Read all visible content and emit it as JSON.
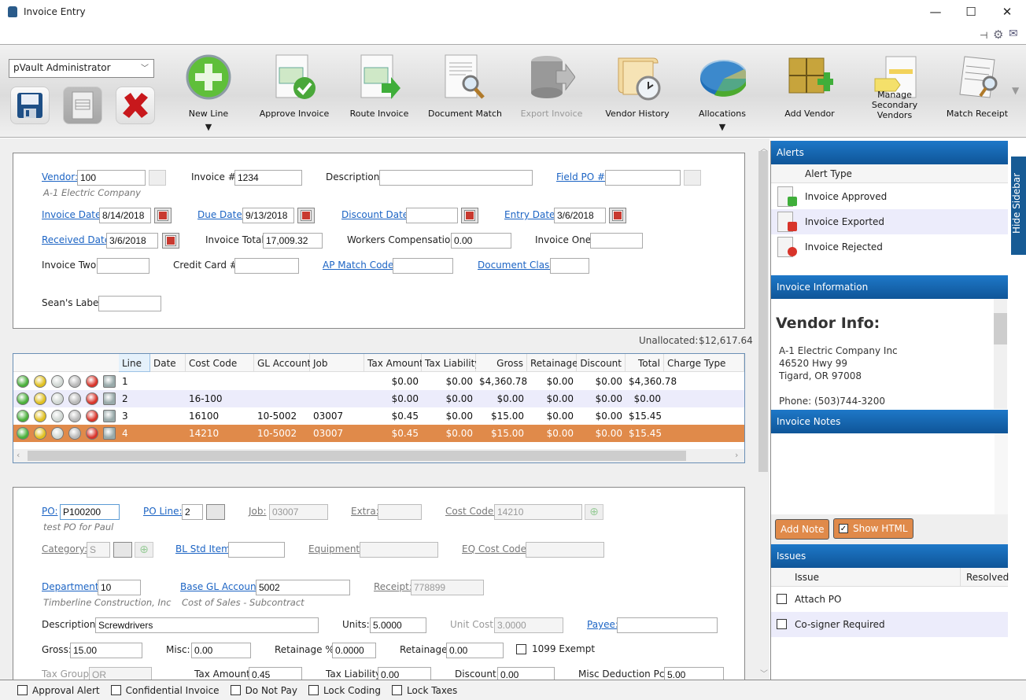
{
  "window": {
    "title": "Invoice Entry",
    "minimize": "—",
    "maximize": "☐",
    "close": "✕"
  },
  "toolbar": {
    "user_select": "pVault Administrator",
    "buttons": [
      {
        "label": "New Line",
        "icon": "plus-circle-icon",
        "dropdown": true
      },
      {
        "label": "Approve Invoice",
        "icon": "invoice-check-icon"
      },
      {
        "label": "Route Invoice",
        "icon": "invoice-arrow-icon"
      },
      {
        "label": "Document Match",
        "icon": "document-magnifier-icon"
      },
      {
        "label": "Export Invoice",
        "icon": "database-export-icon",
        "disabled": true
      },
      {
        "label": "Vendor History",
        "icon": "scroll-clock-icon"
      },
      {
        "label": "Allocations",
        "icon": "pie-chart-icon",
        "dropdown": true
      },
      {
        "label": "Add Vendor",
        "icon": "box-plus-icon"
      },
      {
        "label": "Manage Secondary Vendors",
        "icon": "quotation-tag-icon"
      },
      {
        "label": "Match Receipt",
        "icon": "receipt-magnifier-icon"
      }
    ],
    "caret": "▼"
  },
  "header": {
    "vendor_label": "Vendor:",
    "vendor": "100",
    "vendor_name": "A-1 Electric Company",
    "invoice_no_label": "Invoice #:",
    "invoice_no": "1234",
    "description_label": "Description:",
    "description": "",
    "field_po_label": "Field PO #:",
    "field_po": "",
    "invoice_date_label": "Invoice Date:",
    "invoice_date": "8/14/2018",
    "due_date_label": "Due Date:",
    "due_date": "9/13/2018",
    "discount_date_label": "Discount Date:",
    "discount_date": "",
    "entry_date_label": "Entry Date:",
    "entry_date": "3/6/2018",
    "received_date_label": "Received Date:",
    "received_date": "3/6/2018",
    "invoice_total_label": "Invoice Total:",
    "invoice_total": "17,009.32",
    "workers_comp_label": "Workers Compensation:",
    "workers_comp": "0.00",
    "invoice_one_label": "Invoice One:",
    "invoice_one": "",
    "invoice_two_label": "Invoice Two:",
    "invoice_two": "",
    "credit_card_label": "Credit Card #:",
    "credit_card": "",
    "ap_match_label": "AP Match Code:",
    "ap_match": "",
    "doc_class_label": "Document Class:",
    "doc_class": "",
    "seans_label_label": "Sean's Label:",
    "seans_label": ""
  },
  "unallocated": {
    "label": "Unallocated:",
    "value": "$12,617.64"
  },
  "grid": {
    "columns": [
      "Line",
      "Date",
      "Cost Code",
      "GL Account",
      "Job",
      "Tax Amount",
      "Tax Liability",
      "Gross",
      "Retainage",
      "Discount",
      "Total",
      "Charge Type"
    ],
    "rows": [
      {
        "line": "1",
        "date": "",
        "cost_code": "",
        "gl": "",
        "job": "",
        "tax": "$0.00",
        "liab": "$0.00",
        "gross": "$4,360.78",
        "ret": "$0.00",
        "disc": "$0.00",
        "total": "$4,360.78",
        "charge": ""
      },
      {
        "line": "2",
        "date": "",
        "cost_code": "16-100",
        "gl": "",
        "job": "",
        "tax": "$0.00",
        "liab": "$0.00",
        "gross": "$0.00",
        "ret": "$0.00",
        "disc": "$0.00",
        "total": "$0.00",
        "charge": ""
      },
      {
        "line": "3",
        "date": "",
        "cost_code": "16100",
        "gl": "10-5002",
        "job": "03007",
        "tax": "$0.45",
        "liab": "$0.00",
        "gross": "$15.00",
        "ret": "$0.00",
        "disc": "$0.00",
        "total": "$15.45",
        "charge": ""
      },
      {
        "line": "4",
        "date": "",
        "cost_code": "14210",
        "gl": "10-5002",
        "job": "03007",
        "tax": "$0.45",
        "liab": "$0.00",
        "gross": "$15.00",
        "ret": "$0.00",
        "disc": "$0.00",
        "total": "$15.45",
        "charge": "",
        "selected": true
      }
    ],
    "selected_color": "#e08a4a"
  },
  "detail": {
    "po_label": "PO:",
    "po": "P100200",
    "po_desc": "test PO for Paul",
    "po_line_label": "PO Line:",
    "po_line": "2",
    "job_label": "Job:",
    "job": "03007",
    "extra_label": "Extra:",
    "extra": "",
    "cost_code_label": "Cost Code:",
    "cost_code": "14210",
    "category_label": "Category:",
    "category": "S",
    "bl_std_label": "BL Std Item:",
    "bl_std": "",
    "equipment_label": "Equipment:",
    "equipment": "",
    "eq_cost_label": "EQ Cost Code:",
    "eq_cost": "",
    "department_label": "Department:",
    "department": "10",
    "department_desc": "Timberline Construction, Inc",
    "base_gl_label": "Base GL Account:",
    "base_gl": "5002",
    "base_gl_desc": "Cost of Sales - Subcontract",
    "receipt_label": "Receipt:",
    "receipt": "778899",
    "description_label": "Description:",
    "description": "Screwdrivers",
    "units_label": "Units:",
    "units": "5.0000",
    "unit_cost_label": "Unit Cost:",
    "unit_cost": "3.0000",
    "payee_label": "Payee:",
    "payee": "",
    "gross_label": "Gross:",
    "gross": "15.00",
    "misc_label": "Misc:",
    "misc": "0.00",
    "ret_pct_label": "Retainage %:",
    "ret_pct": "0.0000",
    "retainage_label": "Retainage:",
    "retainage": "0.00",
    "exempt_label": "1099 Exempt",
    "tax_group_label": "Tax Group:",
    "tax_group": "OR",
    "tax_amount_label": "Tax Amount:",
    "tax_amount": "0.45",
    "tax_liab_label": "Tax Liability:",
    "tax_liab": "0.00",
    "discount_label": "Discount:",
    "discount": "0.00",
    "misc_ded_label": "Misc Deduction Pct:",
    "misc_ded": "5.00"
  },
  "sidebar": {
    "hide_label": "Hide Sidebar",
    "alerts": {
      "title": "Alerts",
      "column": "Alert Type",
      "items": [
        "Invoice Approved",
        "Invoice Exported",
        "Invoice Rejected"
      ]
    },
    "info": {
      "title": "Invoice Information",
      "heading": "Vendor Info:",
      "lines": [
        "A-1 Electric Company Inc",
        "46520 Hwy 99",
        "Tigard, OR 97008",
        "",
        "Phone: (503)744-3200"
      ]
    },
    "notes": {
      "title": "Invoice Notes",
      "add_note": "Add Note",
      "show_html": "Show HTML"
    },
    "issues": {
      "title": "Issues",
      "col_issue": "Issue",
      "col_resolved": "Resolved",
      "items": [
        "Attach PO",
        "Co-signer Required"
      ]
    }
  },
  "footer": {
    "checks": [
      "Approval Alert",
      "Confidential Invoice",
      "Do Not Pay",
      "Lock Coding",
      "Lock Taxes"
    ]
  }
}
